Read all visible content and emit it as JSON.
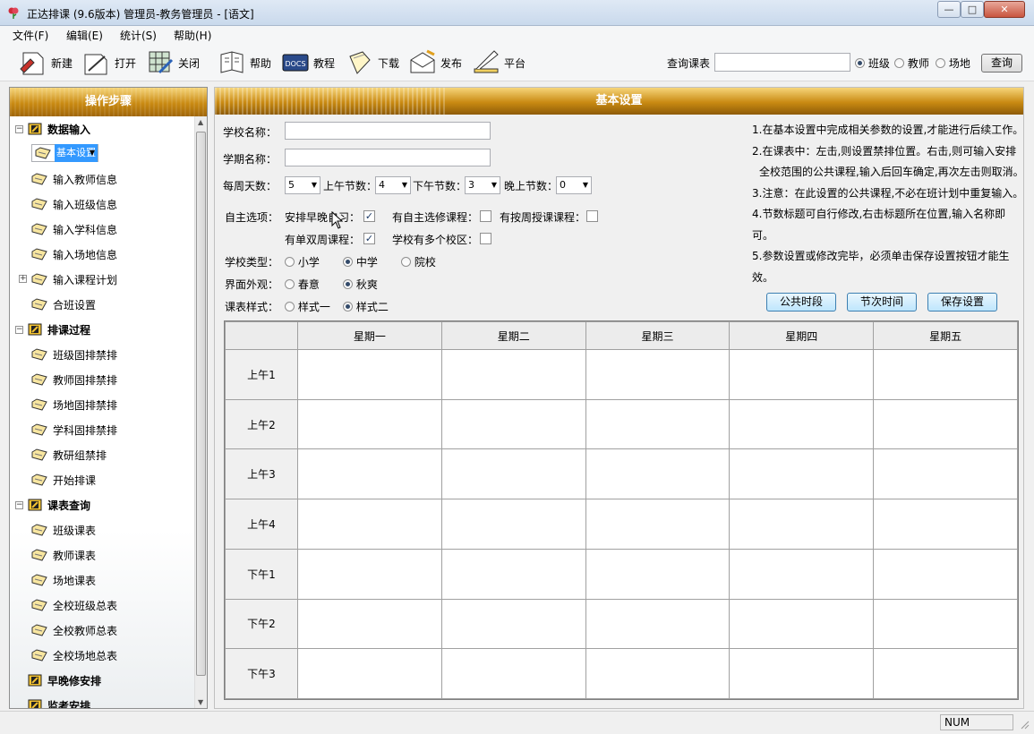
{
  "window": {
    "title": "正达排课 (9.6版本)  管理员-教务管理员 - [语文]",
    "minimize": "—",
    "maximize": "□",
    "close": "✕"
  },
  "menu": [
    "文件(F)",
    "编辑(E)",
    "统计(S)",
    "帮助(H)"
  ],
  "toolbar": {
    "new": "新建",
    "open": "打开",
    "close": "关闭",
    "help": "帮助",
    "tutorial": "教程",
    "download": "下载",
    "publish": "发布",
    "platform": "平台",
    "query_label": "查询课表",
    "query_value": "",
    "radio_class": "班级",
    "radio_teacher": "教师",
    "radio_venue": "场地",
    "query_button": "查询"
  },
  "sidebar": {
    "header": "操作步骤",
    "groups": [
      {
        "label": "数据输入",
        "expander": "−",
        "items": [
          "基本设置",
          "输入教师信息",
          "输入班级信息",
          "输入学科信息",
          "输入场地信息",
          "输入课程计划",
          "合班设置"
        ]
      },
      {
        "label": "排课过程",
        "expander": "−",
        "items": [
          "班级固排禁排",
          "教师固排禁排",
          "场地固排禁排",
          "学科固排禁排",
          "教研组禁排",
          "开始排课"
        ]
      },
      {
        "label": "课表查询",
        "expander": "−",
        "items": [
          "班级课表",
          "教师课表",
          "场地课表",
          "全校班级总表",
          "全校教师总表",
          "全校场地总表"
        ]
      },
      {
        "label": "早晚修安排",
        "items": []
      },
      {
        "label": "监考安排",
        "items": []
      }
    ],
    "selected": "基本设置"
  },
  "main": {
    "header": "基本设置",
    "school_name_label": "学校名称：",
    "school_name_value": "",
    "term_name_label": "学期名称：",
    "term_name_value": "",
    "days_label": "每周天数：",
    "days_value": "5",
    "am_label": "上午节数：",
    "am_value": "4",
    "pm_label": "下午节数：",
    "pm_value": "3",
    "eve_label": "晚上节数：",
    "eve_value": "0",
    "options_label": "自主选项：",
    "opt_morning_evening": "安排早晚自习：",
    "opt_elective": "有自主选修课程：",
    "opt_weekly": "有按周授课课程：",
    "opt_biweekly": "有单双周课程：",
    "opt_multi_campus": "学校有多个校区：",
    "check_mark": "✓",
    "school_type_label": "学校类型：",
    "type_primary": "小学",
    "type_middle": "中学",
    "type_college": "院校",
    "appearance_label": "界面外观：",
    "look_spring": "春意",
    "look_autumn": "秋爽",
    "table_style_label": "课表样式：",
    "style_one": "样式一",
    "style_two": "样式二",
    "btn_public_slots": "公共时段",
    "btn_period_time": "节次时间",
    "btn_save": "保存设置",
    "notes": [
      "1.在基本设置中完成相关参数的设置,才能进行后续工作。",
      "2.在课表中：左击,则设置禁排位置。右击,则可输入安排",
      "  全校范围的公共课程,输入后回车确定,再次左击则取消。",
      "3.注意：在此设置的公共课程,不必在班计划中重复输入。",
      "4.节数标题可自行修改,右击标题所在位置,输入名称即可。",
      "5.参数设置或修改完毕，必须单击保存设置按钮才能生效。"
    ],
    "grid": {
      "days": [
        "星期一",
        "星期二",
        "星期三",
        "星期四",
        "星期五"
      ],
      "periods": [
        "上午1",
        "上午2",
        "上午3",
        "上午4",
        "下午1",
        "下午2",
        "下午3"
      ]
    }
  },
  "status": {
    "num": "NUM"
  }
}
